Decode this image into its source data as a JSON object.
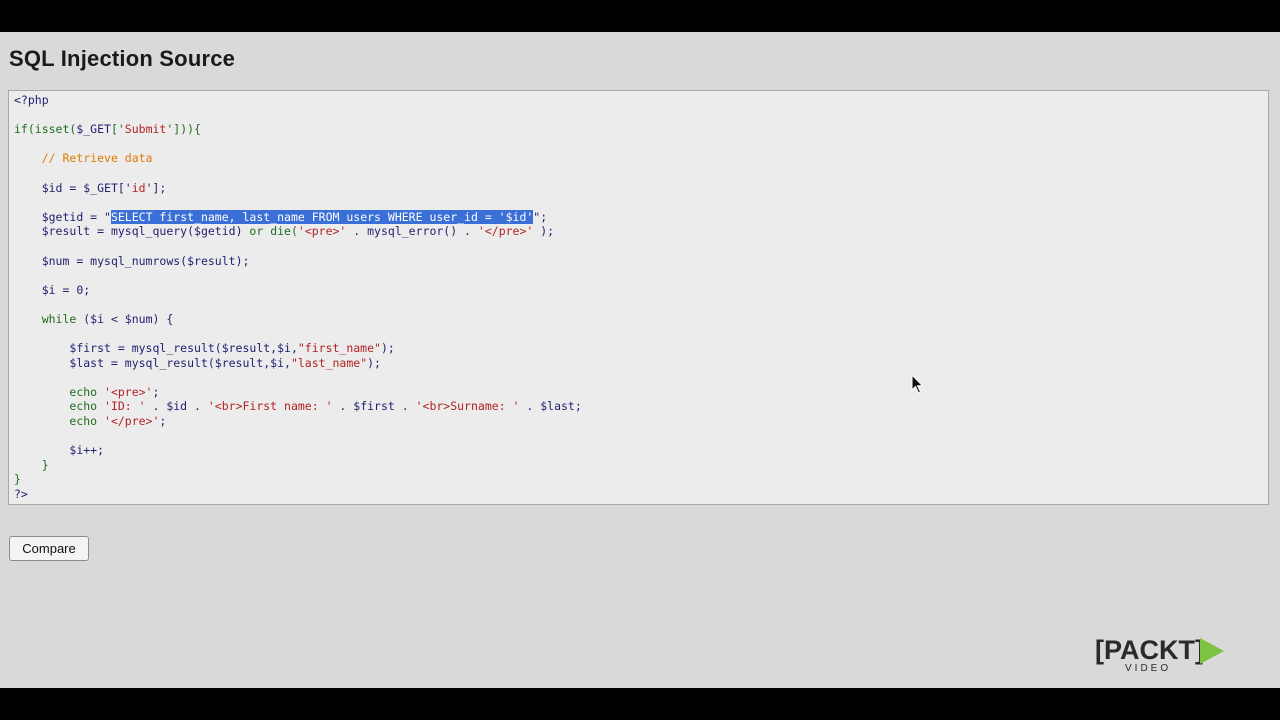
{
  "page": {
    "title": "SQL Injection Source"
  },
  "source": {
    "lines": [
      {
        "indent": "",
        "parts": [
          {
            "t": "<?php",
            "c": "c-php"
          }
        ]
      },
      {
        "indent": "",
        "parts": []
      },
      {
        "indent": "",
        "parts": [
          {
            "t": "if(isset(",
            "c": "c-kw"
          },
          {
            "t": "$_GET",
            "c": "c-var"
          },
          {
            "t": "['",
            "c": "c-kw"
          },
          {
            "t": "Submit",
            "c": "c-str"
          },
          {
            "t": "'])){",
            "c": "c-kw"
          }
        ]
      },
      {
        "indent": "",
        "parts": []
      },
      {
        "indent": "    ",
        "parts": [
          {
            "t": "// Retrieve data",
            "c": "c-cmt"
          }
        ]
      },
      {
        "indent": "",
        "parts": []
      },
      {
        "indent": "    ",
        "parts": [
          {
            "t": "$id = $_GET['",
            "c": "c-var"
          },
          {
            "t": "id",
            "c": "c-str"
          },
          {
            "t": "'];",
            "c": "c-var"
          }
        ]
      },
      {
        "indent": "",
        "parts": []
      },
      {
        "indent": "    ",
        "parts": [
          {
            "t": "$getid = \"",
            "c": "c-var"
          },
          {
            "t": "SELECT first_name, last_name FROM users WHERE user_id = '$id'",
            "c": "sel"
          },
          {
            "t": "\";",
            "c": "c-var"
          }
        ]
      },
      {
        "indent": "    ",
        "parts": [
          {
            "t": "$result = mysql_query($getid) ",
            "c": "c-var"
          },
          {
            "t": "or die(",
            "c": "c-kw"
          },
          {
            "t": "'<pre>'",
            "c": "c-str"
          },
          {
            "t": " . mysql_error() . ",
            "c": "c-var"
          },
          {
            "t": "'</pre>'",
            "c": "c-str"
          },
          {
            "t": " );",
            "c": "c-var"
          }
        ]
      },
      {
        "indent": "",
        "parts": []
      },
      {
        "indent": "    ",
        "parts": [
          {
            "t": "$num = mysql_numrows($result);",
            "c": "c-var"
          }
        ]
      },
      {
        "indent": "",
        "parts": []
      },
      {
        "indent": "    ",
        "parts": [
          {
            "t": "$i = 0;",
            "c": "c-var"
          }
        ]
      },
      {
        "indent": "",
        "parts": []
      },
      {
        "indent": "    ",
        "parts": [
          {
            "t": "while",
            "c": "c-kw"
          },
          {
            "t": " ($i < $num) {",
            "c": "c-var"
          }
        ]
      },
      {
        "indent": "",
        "parts": []
      },
      {
        "indent": "        ",
        "parts": [
          {
            "t": "$first = mysql_result($result,$i,",
            "c": "c-var"
          },
          {
            "t": "\"first_name\"",
            "c": "c-str"
          },
          {
            "t": ");",
            "c": "c-var"
          }
        ]
      },
      {
        "indent": "        ",
        "parts": [
          {
            "t": "$last = mysql_result($result,$i,",
            "c": "c-var"
          },
          {
            "t": "\"last_name\"",
            "c": "c-str"
          },
          {
            "t": ");",
            "c": "c-var"
          }
        ]
      },
      {
        "indent": "",
        "parts": []
      },
      {
        "indent": "        ",
        "parts": [
          {
            "t": "echo ",
            "c": "c-kw"
          },
          {
            "t": "'<pre>'",
            "c": "c-str"
          },
          {
            "t": ";",
            "c": "c-var"
          }
        ]
      },
      {
        "indent": "        ",
        "parts": [
          {
            "t": "echo ",
            "c": "c-kw"
          },
          {
            "t": "'ID: '",
            "c": "c-str"
          },
          {
            "t": " . $id . ",
            "c": "c-var"
          },
          {
            "t": "'<br>First name: '",
            "c": "c-str"
          },
          {
            "t": " . $first . ",
            "c": "c-var"
          },
          {
            "t": "'<br>Surname: '",
            "c": "c-str"
          },
          {
            "t": " . $last;",
            "c": "c-var"
          }
        ]
      },
      {
        "indent": "        ",
        "parts": [
          {
            "t": "echo ",
            "c": "c-kw"
          },
          {
            "t": "'</pre>'",
            "c": "c-str"
          },
          {
            "t": ";",
            "c": "c-var"
          }
        ]
      },
      {
        "indent": "",
        "parts": []
      },
      {
        "indent": "        ",
        "parts": [
          {
            "t": "$i++;",
            "c": "c-var"
          }
        ]
      },
      {
        "indent": "    ",
        "parts": [
          {
            "t": "}",
            "c": "c-kw"
          }
        ]
      },
      {
        "indent": "",
        "parts": [
          {
            "t": "}",
            "c": "c-kw"
          }
        ]
      },
      {
        "indent": "",
        "parts": [
          {
            "t": "?>",
            "c": "c-php"
          }
        ]
      }
    ]
  },
  "actions": {
    "compare_label": "Compare"
  },
  "logo": {
    "brand": "[PACKT]",
    "sub": "VIDEO"
  },
  "icons": {
    "cursor": "mouse-pointer-icon",
    "logo_play": "play-triangle-icon"
  },
  "colors": {
    "accent_play": "#7dc242",
    "selection": "#3a6fd8"
  }
}
